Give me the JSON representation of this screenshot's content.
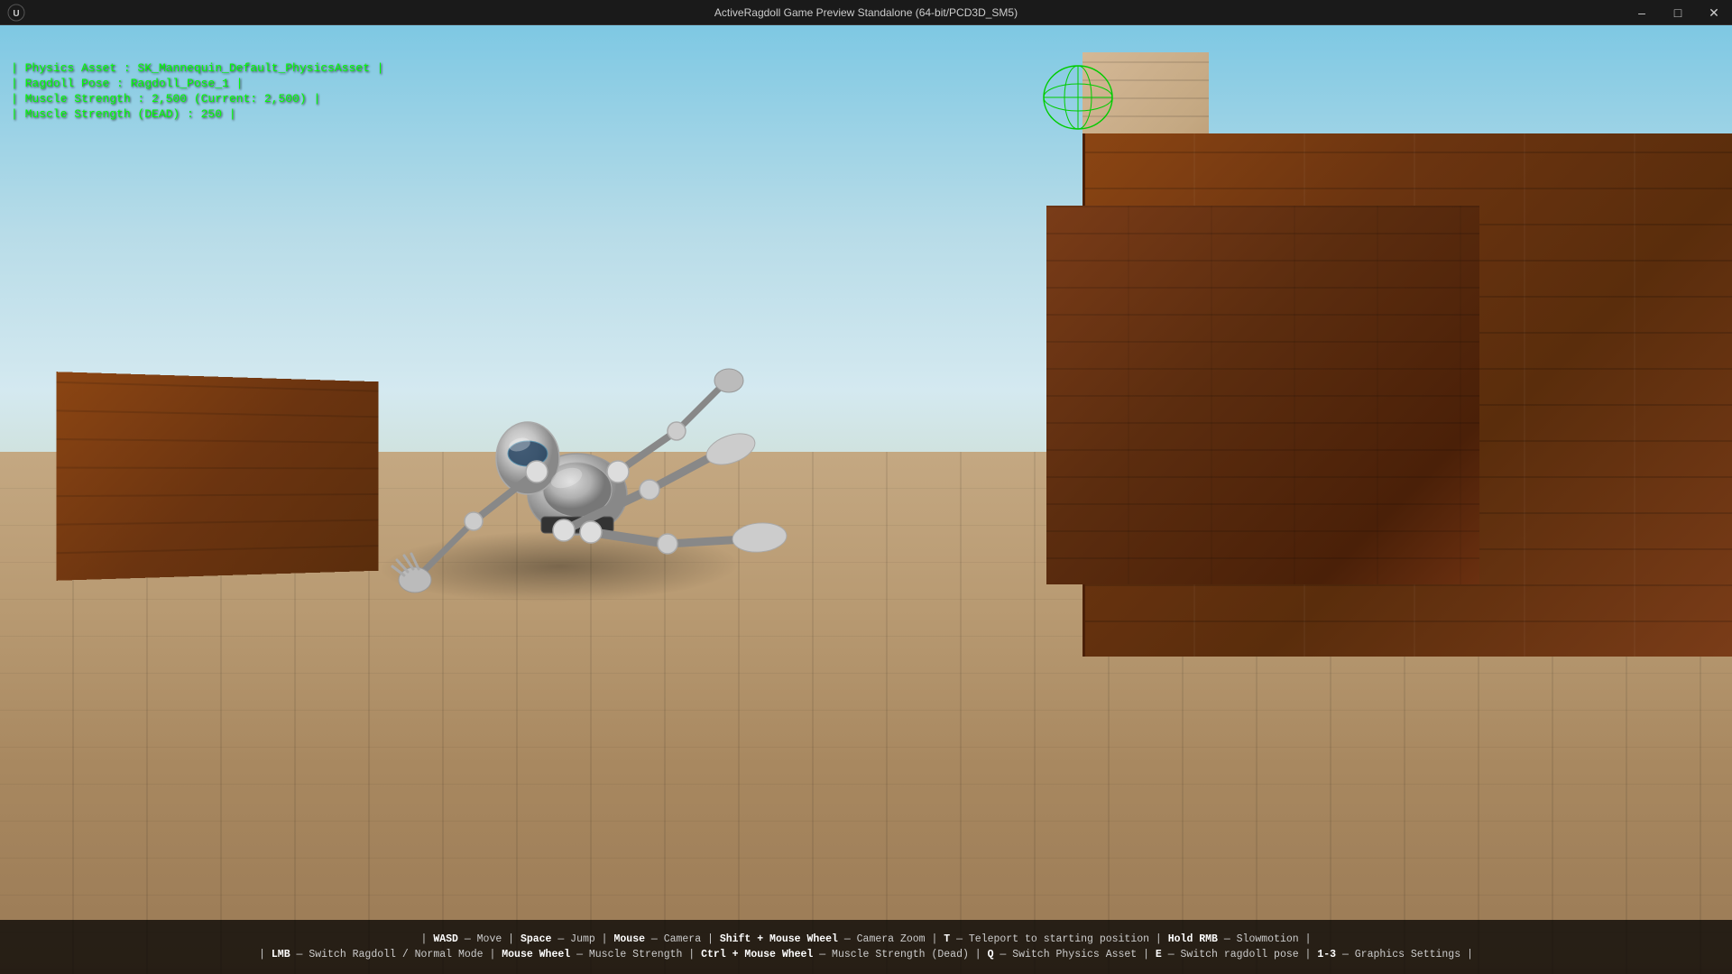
{
  "titlebar": {
    "title": "ActiveRagdoll Game Preview Standalone (64-bit/PCD3D_SM5)",
    "minimize": "–",
    "maximize": "□",
    "close": "✕"
  },
  "hud": {
    "physics_asset_label": "| Physics Asset : SK_Mannequin_Default_PhysicsAsset |",
    "ragdoll_pose_label": "| Ragdoll Pose : Ragdoll_Pose_1 |",
    "muscle_strength_label": "| Muscle Strength : 2,500 (Current: 2,500) |",
    "muscle_strength_dead_label": "| Muscle Strength (DEAD) : 250 |"
  },
  "controls": {
    "line1": "| WASD — Move | Space — Jump | Mouse — Camera | Shift + Mouse Wheel — Camera Zoom | T — Teleport to starting position | Hold RMB — Slowmotion |",
    "line2": "| LMB — Switch Ragdoll / Normal Mode | Mouse Wheel — Muscle Strength | Ctrl + Mouse Wheel — Muscle Strength (Dead) | Q — Switch Physics Asset | E — Switch ragdoll pose | 1-3 — Graphics Settings |"
  }
}
